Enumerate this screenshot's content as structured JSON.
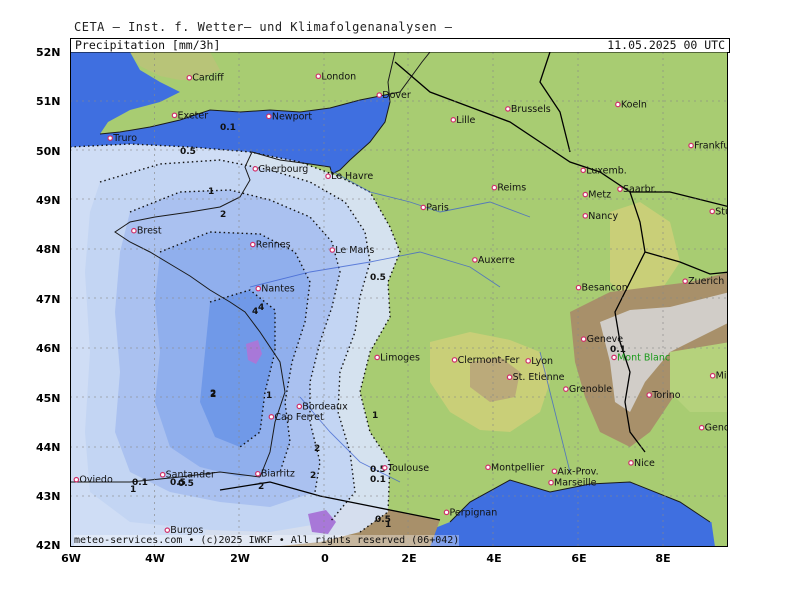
{
  "header": {
    "credit": "CETA – Inst. f. Wetter– und Klimafolgenanalysen –"
  },
  "title_bar": {
    "variable": "Precipitation [mm/3h]",
    "valid_time": "11.05.2025 00 UTC"
  },
  "footer": {
    "credit": "meteo-services.com • (c)2025 IWKF • All rights reserved (06+042)"
  },
  "axes": {
    "lat_labels": [
      "52N",
      "51N",
      "50N",
      "49N",
      "48N",
      "47N",
      "46N",
      "45N",
      "44N",
      "43N",
      "42N"
    ],
    "lon_labels": [
      "6W",
      "4W",
      "2W",
      "0",
      "2E",
      "4E",
      "6E",
      "8E"
    ]
  },
  "colors": {
    "sea": "#3f6fe0",
    "land_low": "#a8cc72",
    "land_mid": "#c9cf78",
    "land_high": "#a8906a",
    "alps_snow": "#d8d8d8",
    "precip_0_1": "#d7e3f6",
    "precip_0_5": "#c2d4f2",
    "precip_1": "#a9c0ef",
    "precip_2": "#8eaeec",
    "precip_4": "#6f98e8",
    "precip_heavy": "#a878d8"
  },
  "cities": [
    {
      "name": "Cardiff",
      "lon": -3.18,
      "lat": 51.48
    },
    {
      "name": "London",
      "lon": -0.13,
      "lat": 51.51
    },
    {
      "name": "Dover",
      "lon": 1.31,
      "lat": 51.13
    },
    {
      "name": "Exeter",
      "lon": -3.53,
      "lat": 50.72
    },
    {
      "name": "Newport",
      "lon": -1.3,
      "lat": 50.7
    },
    {
      "name": "Truro",
      "lon": -5.05,
      "lat": 50.26
    },
    {
      "name": "Brussels",
      "lon": 4.35,
      "lat": 50.85
    },
    {
      "name": "Koeln",
      "lon": 6.95,
      "lat": 50.94
    },
    {
      "name": "Lille",
      "lon": 3.06,
      "lat": 50.63
    },
    {
      "name": "Frankfurt",
      "lon": 8.68,
      "lat": 50.11
    },
    {
      "name": "Le Havre",
      "lon": 0.1,
      "lat": 49.49
    },
    {
      "name": "Cherbourg",
      "lon": -1.62,
      "lat": 49.64
    },
    {
      "name": "Luxemb.",
      "lon": 6.13,
      "lat": 49.61
    },
    {
      "name": "Reims",
      "lon": 4.03,
      "lat": 49.26
    },
    {
      "name": "Saarbr.",
      "lon": 7.0,
      "lat": 49.23
    },
    {
      "name": "Metz",
      "lon": 6.18,
      "lat": 49.12
    },
    {
      "name": "Paris",
      "lon": 2.35,
      "lat": 48.86
    },
    {
      "name": "Nancy",
      "lon": 6.18,
      "lat": 48.69
    },
    {
      "name": "Stuttgart",
      "lon": 9.18,
      "lat": 48.78
    },
    {
      "name": "Brest",
      "lon": -4.49,
      "lat": 48.39
    },
    {
      "name": "Rennes",
      "lon": -1.68,
      "lat": 48.11
    },
    {
      "name": "Le Mans",
      "lon": 0.2,
      "lat": 48.0
    },
    {
      "name": "Auxerre",
      "lon": 3.57,
      "lat": 47.8
    },
    {
      "name": "Zuerich",
      "lon": 8.54,
      "lat": 47.37
    },
    {
      "name": "Nantes",
      "lon": -1.55,
      "lat": 47.22
    },
    {
      "name": "Besancon",
      "lon": 6.02,
      "lat": 47.24
    },
    {
      "name": "Geneve",
      "lon": 6.14,
      "lat": 46.2
    },
    {
      "name": "Limoges",
      "lon": 1.26,
      "lat": 45.83
    },
    {
      "name": "Clermont-Fer",
      "lon": 3.09,
      "lat": 45.78
    },
    {
      "name": "Lyon",
      "lon": 4.83,
      "lat": 45.76
    },
    {
      "name": "Mont Blanc",
      "lon": 6.86,
      "lat": 45.83
    },
    {
      "name": "St. Etienne",
      "lon": 4.39,
      "lat": 45.43
    },
    {
      "name": "Grenoble",
      "lon": 5.72,
      "lat": 45.19
    },
    {
      "name": "Milano",
      "lon": 9.19,
      "lat": 45.46
    },
    {
      "name": "Bordeaux",
      "lon": -0.58,
      "lat": 44.84
    },
    {
      "name": "Torino",
      "lon": 7.69,
      "lat": 45.07
    },
    {
      "name": "Cap Ferret",
      "lon": -1.24,
      "lat": 44.63
    },
    {
      "name": "Genova",
      "lon": 8.93,
      "lat": 44.41
    },
    {
      "name": "Montpellier",
      "lon": 3.88,
      "lat": 43.61
    },
    {
      "name": "Nice",
      "lon": 7.26,
      "lat": 43.7
    },
    {
      "name": "Toulouse",
      "lon": 1.44,
      "lat": 43.6
    },
    {
      "name": "Aix-Prov.",
      "lon": 5.45,
      "lat": 43.53
    },
    {
      "name": "Biarritz",
      "lon": -1.56,
      "lat": 43.48
    },
    {
      "name": "Oviedo",
      "lon": -5.85,
      "lat": 43.36
    },
    {
      "name": "Santander",
      "lon": -3.81,
      "lat": 43.46
    },
    {
      "name": "Marseille",
      "lon": 5.37,
      "lat": 43.3
    },
    {
      "name": "Perpignan",
      "lon": 2.9,
      "lat": 42.7
    },
    {
      "name": "Burgos",
      "lon": -3.7,
      "lat": 42.34
    }
  ],
  "contour_labels": [
    "0.1",
    "0.5",
    "1",
    "2",
    "4",
    "0.5",
    "1",
    "2",
    "2",
    "2",
    "1",
    "0.5",
    "0.1",
    "0.5",
    "1",
    "0.1",
    "4",
    "2",
    "0.5",
    "0.1",
    "0.5",
    "1",
    "2"
  ]
}
